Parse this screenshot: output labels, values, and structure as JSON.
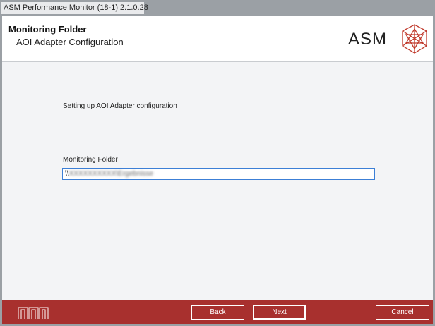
{
  "window": {
    "title": "ASM Performance Monitor (18-1)  2.1.0.28"
  },
  "header": {
    "title": "Monitoring Folder",
    "subtitle": "AOI Adapter Configuration",
    "brand": "ASM"
  },
  "main": {
    "intro": "Setting up AOI Adapter configuration",
    "folder_label": "Monitoring Folder",
    "folder_value_prefix": "\\\\",
    "folder_value_blurred": "XXXXXXXXXX\\Ergebnisse"
  },
  "footer": {
    "back": "Back",
    "next": "Next",
    "cancel": "Cancel"
  },
  "colors": {
    "accent": "#a8302e",
    "logo": "#c0392b"
  }
}
